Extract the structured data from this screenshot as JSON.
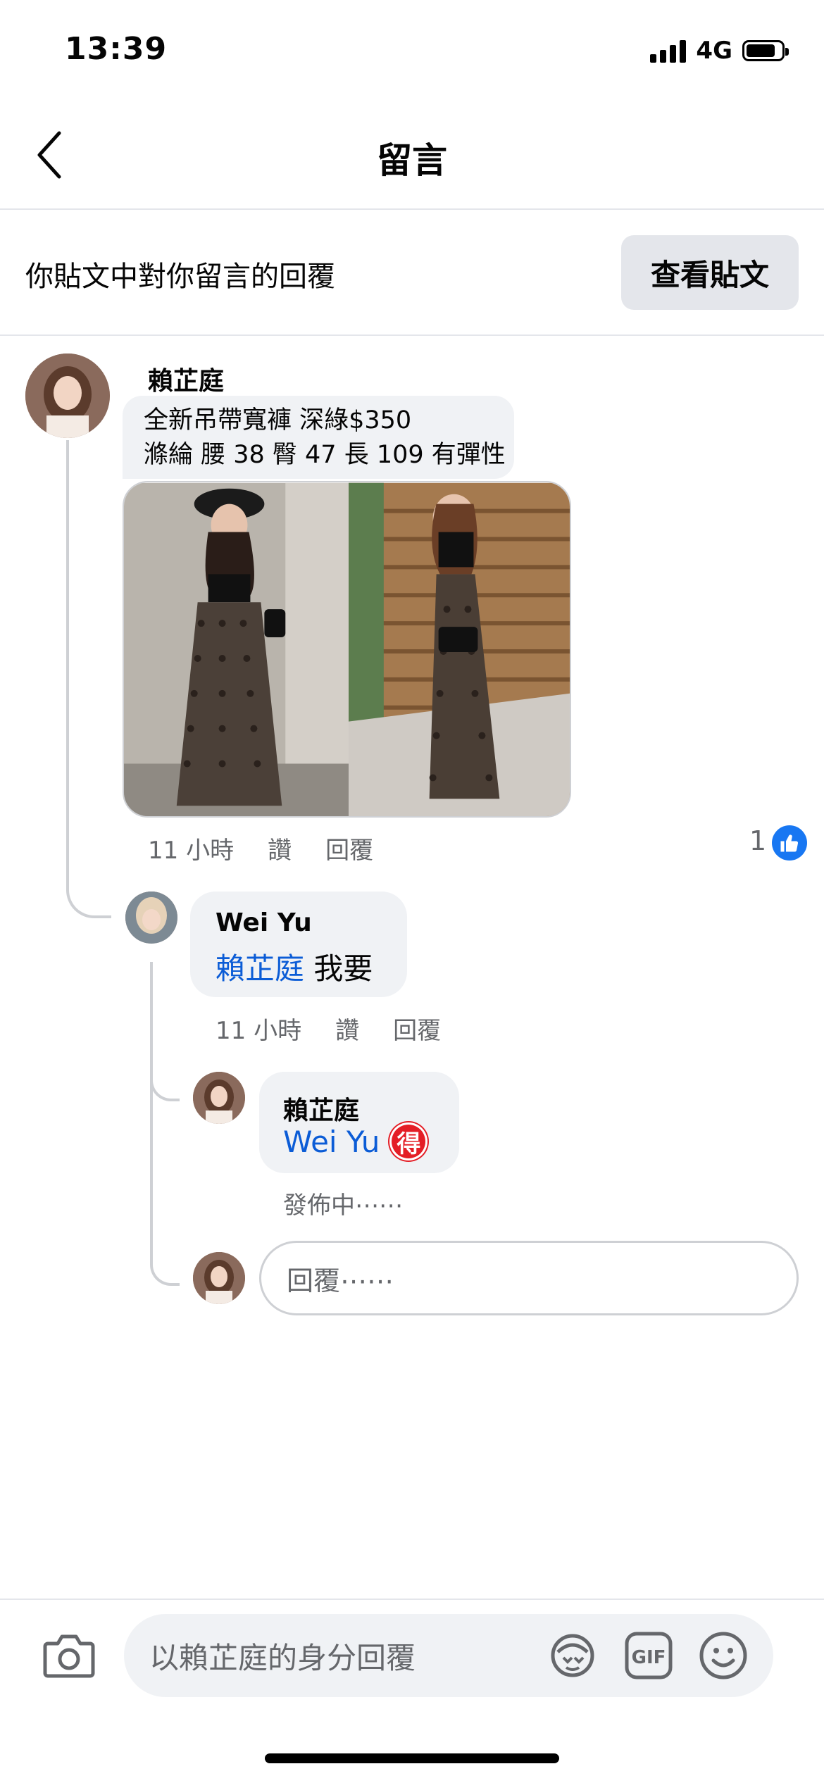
{
  "status_bar": {
    "time": "13:39",
    "network": "4G"
  },
  "header": {
    "title": "留言"
  },
  "banner": {
    "text": "你貼文中對你留言的回覆",
    "button_label": "查看貼文"
  },
  "comment": {
    "author": "賴芷庭",
    "line1": "全新吊帶寬褲 深綠$350",
    "line2": "滌綸 腰 38 臀 47 長 109 有彈性",
    "time": "11 小時",
    "like_label": "讚",
    "reply_label": "回覆",
    "reaction_count": "1"
  },
  "reply1": {
    "author": "Wei Yu",
    "mention": "賴芷庭",
    "text": "我要",
    "time": "11 小時",
    "like_label": "讚",
    "reply_label": "回覆"
  },
  "reply2": {
    "author": "賴芷庭",
    "mention": "Wei Yu",
    "badge": "得",
    "status": "發佈中⋯⋯"
  },
  "reply_input": {
    "placeholder": "回覆⋯⋯"
  },
  "composer": {
    "placeholder": "以賴芷庭的身分回覆"
  },
  "colors": {
    "link": "#0b5cd6",
    "like_blue": "#1877f2",
    "bubble": "#f0f2f5",
    "badge_red": "#e41e26"
  },
  "icons": [
    "chevron-left-icon",
    "camera-icon",
    "sticker-icon",
    "gif-icon",
    "emoji-icon",
    "like-icon"
  ]
}
